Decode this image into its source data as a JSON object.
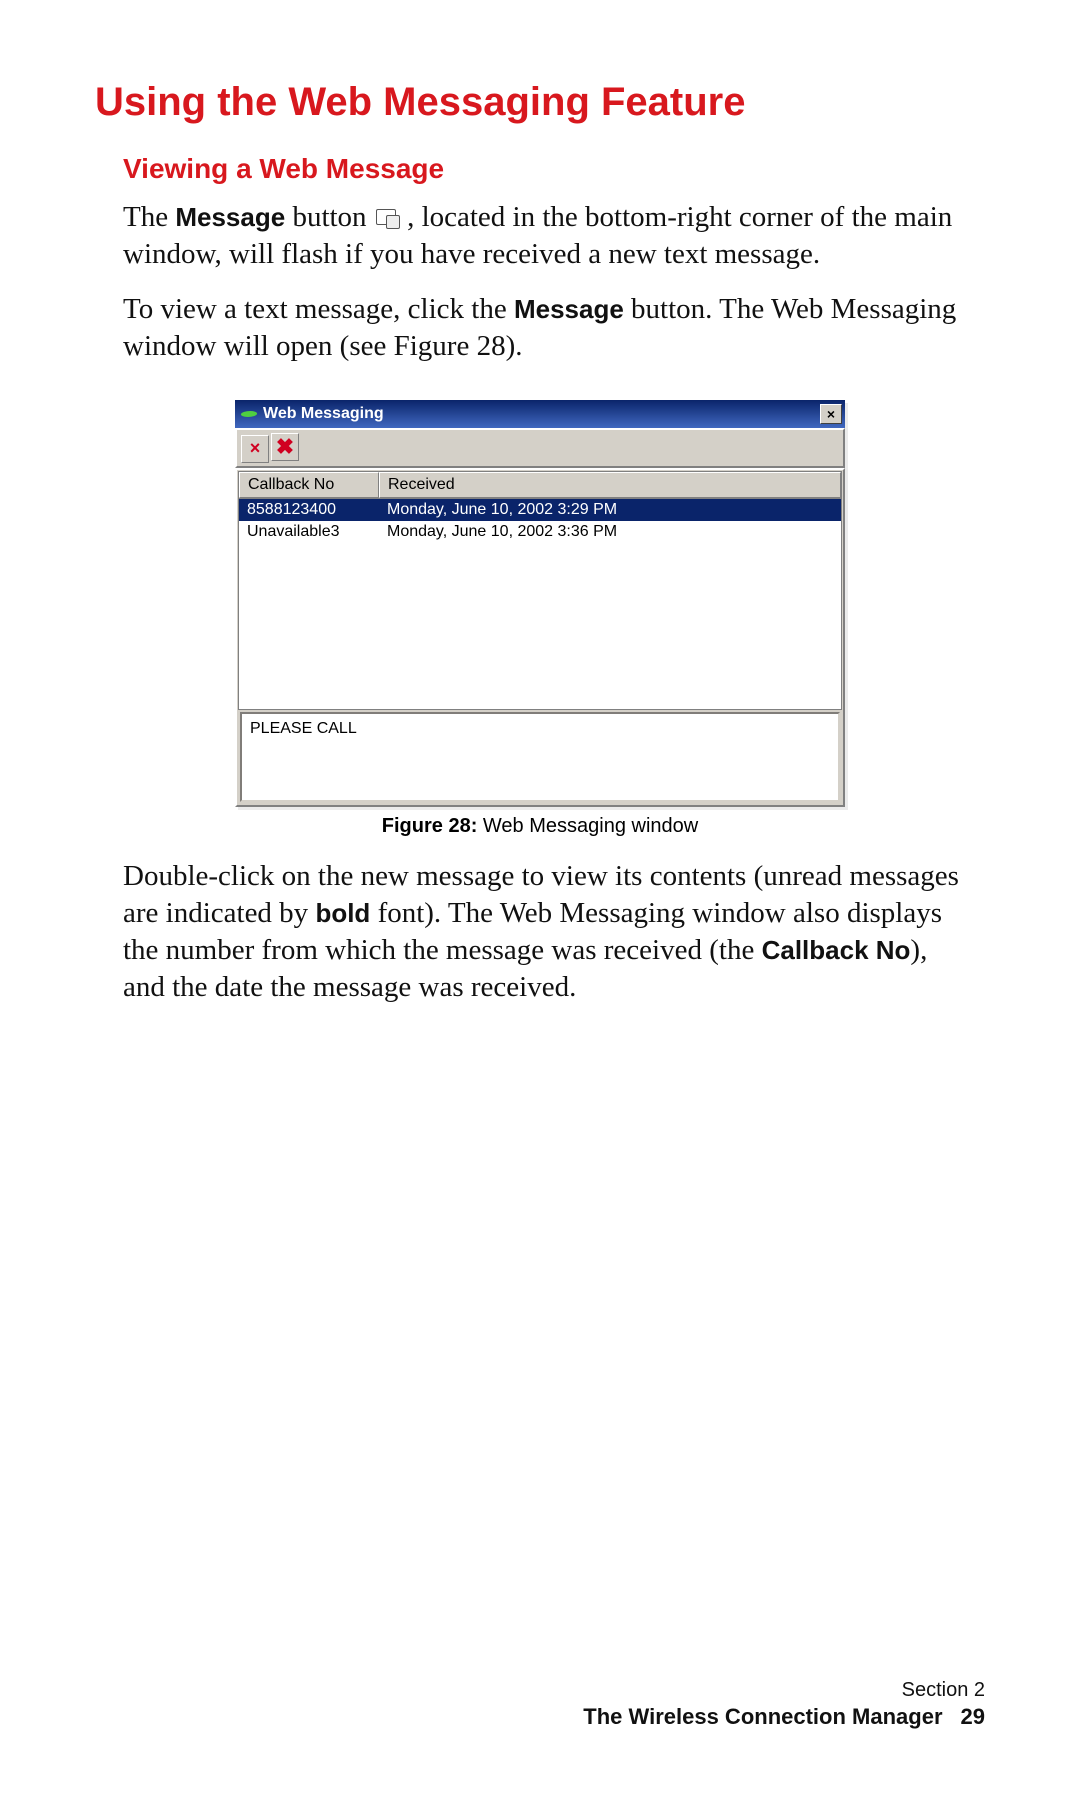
{
  "heading": "Using the Web Messaging Feature",
  "subheading": "Viewing a Web Message",
  "p1a": "The ",
  "p1b": "Message",
  "p1c": " button ",
  "p1d": " , located in the bottom-right corner of the main window, will flash if you have received a new text message.",
  "p2a": "To view a text message, click the ",
  "p2b": "Message",
  "p2c": " button. The Web Messaging window will open (see Figure 28).",
  "window": {
    "title": "Web Messaging",
    "close_glyph": "×",
    "tool1": "×",
    "tool2": "✖",
    "headers": {
      "c1": "Callback No",
      "c2": "Received"
    },
    "rows": [
      {
        "c1": "8588123400",
        "c2": "Monday, June 10, 2002 3:29 PM",
        "selected": true
      },
      {
        "c1": "Unavailable3",
        "c2": "Monday, June 10, 2002 3:36 PM",
        "selected": false
      }
    ],
    "preview": "PLEASE CALL"
  },
  "caption_bold": "Figure 28:",
  "caption_rest": " Web Messaging window",
  "p3a": "Double-click on the new message to view its contents (unread messages are indicated by ",
  "p3b": "bold",
  "p3c": " font). The Web Messaging window also displays the number from which the message was received (the ",
  "p3d": "Callback No",
  "p3e": "), and the date the message was received.",
  "footer": {
    "section": "Section 2",
    "title": "The Wireless Connection Manager",
    "page": "29"
  }
}
